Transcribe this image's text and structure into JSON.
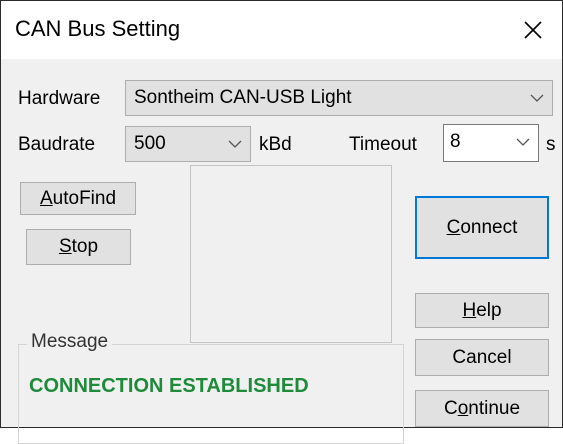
{
  "window": {
    "title": "CAN Bus Setting",
    "close_symbol": "✕"
  },
  "hardware": {
    "label": "Hardware",
    "value": "Sontheim CAN-USB Light"
  },
  "baudrate": {
    "label": "Baudrate",
    "value": "500",
    "unit": "kBd"
  },
  "timeout": {
    "label": "Timeout",
    "value": "8",
    "unit": "s"
  },
  "buttons": {
    "autofind": {
      "accel": "A",
      "rest": "utoFind"
    },
    "stop": {
      "accel": "S",
      "rest": "top"
    },
    "connect": {
      "accel": "C",
      "rest": "onnect"
    },
    "help": {
      "accel": "H",
      "rest": "elp"
    },
    "cancel": {
      "label": "Cancel"
    },
    "continue": {
      "pre": "C",
      "accel": "o",
      "rest": "ntinue"
    }
  },
  "message": {
    "group_label": "Message",
    "status_text": "CONNECTION ESTABLISHED",
    "status_color": "#1e8a3a"
  },
  "colors": {
    "accent": "#0078d7",
    "dialog_bg": "#f0f0f0"
  },
  "icons": {
    "close": "close-icon",
    "dropdown": "chevron-down-icon"
  }
}
